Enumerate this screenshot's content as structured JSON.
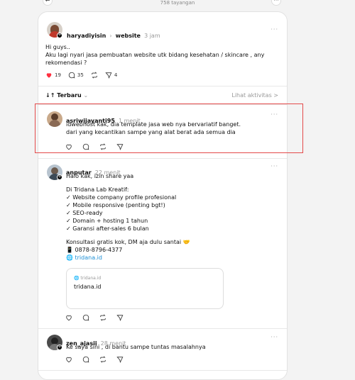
{
  "header": {
    "views": "758 tayangan",
    "back_icon": "arrow-left-icon",
    "more_icon": "more-icon"
  },
  "post": {
    "username": "haryadiyisin",
    "community": "website",
    "time": "3 jam",
    "more": "···",
    "text_1": "Hi guys..",
    "text_2": "Aku lagi nyari jasa pembuatan website utk bidang kesehatan / skincare , any",
    "text_3": "rekomendasi ?",
    "likes": "19",
    "comments": "35",
    "shares": "4"
  },
  "sort": {
    "label": "Terbaru",
    "activity": "Lihat aktivitas >"
  },
  "replies": [
    {
      "username": "asriwijayanti95",
      "time": "1 menit",
      "line1": "idwebhost kak, dia template jasa web nya bervariatif banget.",
      "line2": "dari yang kecantikan sampe yang alat berat ada semua dia"
    },
    {
      "username": "anputar",
      "time": "22 menit",
      "greeting": "Halo kak, izin share yaa",
      "intro": "Di Tridana Lab Kreatif:",
      "bullets": [
        "✓ Website company profile profesional",
        "✓ Mobile responsive (penting bgt!)",
        "✓ SEO-ready",
        "✓ Domain + hosting 1 tahun",
        "✓ Garansi after-sales 6 bulan"
      ],
      "closing": "Konsultasi gratis kok, DM aja dulu santai 🤝",
      "phone": "📱 0878-8796-4377",
      "website": "🌐 tridana.id",
      "preview_domain": "🌐 tridana.id",
      "preview_title": "tridana.id"
    },
    {
      "username": "zen_ajasii",
      "time": "28 menit",
      "line1": "Ke saya sini , di bantu sampe tuntas masalahnya"
    }
  ],
  "colors": {
    "like": "#ff3040",
    "link": "#1d8fd6",
    "highlight": "#e44a4a"
  }
}
